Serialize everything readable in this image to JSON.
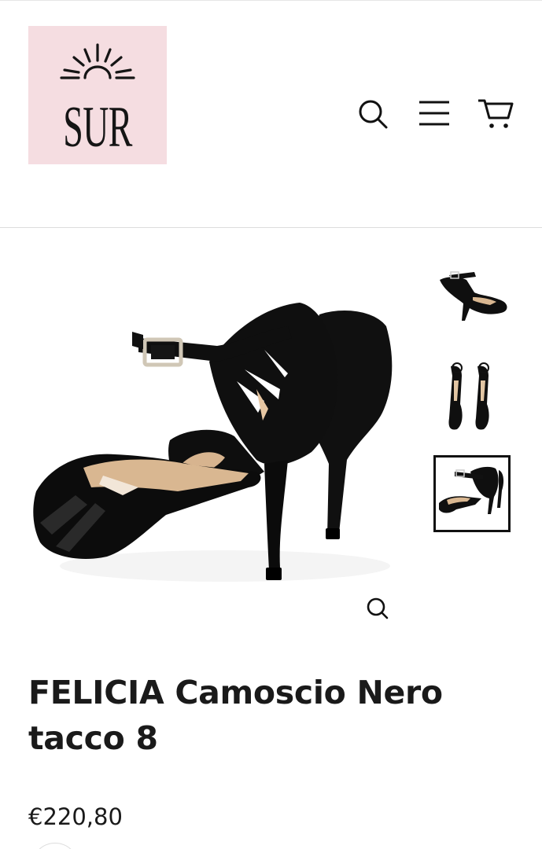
{
  "header": {
    "logo_text": "SUR",
    "logo_bg": "#f5dde1",
    "icons": [
      "search-icon",
      "menu-icon",
      "cart-icon"
    ]
  },
  "gallery": {
    "thumbnails": [
      {
        "view": "side",
        "active": false
      },
      {
        "view": "front-pair",
        "active": false
      },
      {
        "view": "back-pair",
        "active": true
      }
    ],
    "zoom_icon": "zoom-icon"
  },
  "product": {
    "title": "FELICIA Camoscio Nero tacco 8",
    "price": "€220,80"
  }
}
